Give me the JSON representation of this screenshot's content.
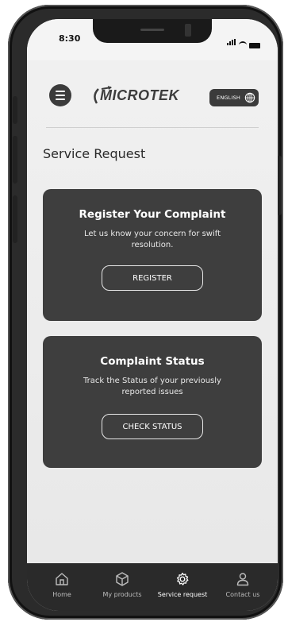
{
  "status_bar": {
    "time": "8:30"
  },
  "header": {
    "logo_text": "MICROTEK",
    "language_label": "ENGLISH"
  },
  "page": {
    "title": "Service Request"
  },
  "cards": {
    "register": {
      "title": "Register Your Complaint",
      "description": "Let us know your concern for swift resolution.",
      "button_label": "REGISTER"
    },
    "status": {
      "title": "Complaint Status",
      "description": "Track the Status of your previously reported issues",
      "button_label": "CHECK STATUS"
    }
  },
  "tabbar": {
    "items": [
      {
        "label": "Home",
        "icon": "home-icon",
        "active": false
      },
      {
        "label": "My products",
        "icon": "cube-icon",
        "active": false
      },
      {
        "label": "Service request",
        "icon": "gear-icon",
        "active": true
      },
      {
        "label": "Contact us",
        "icon": "user-icon",
        "active": false
      }
    ]
  },
  "colors": {
    "card_background": "#3e3e3e",
    "tabbar_background": "#2a2a2a",
    "screen_background": "#ececec"
  }
}
